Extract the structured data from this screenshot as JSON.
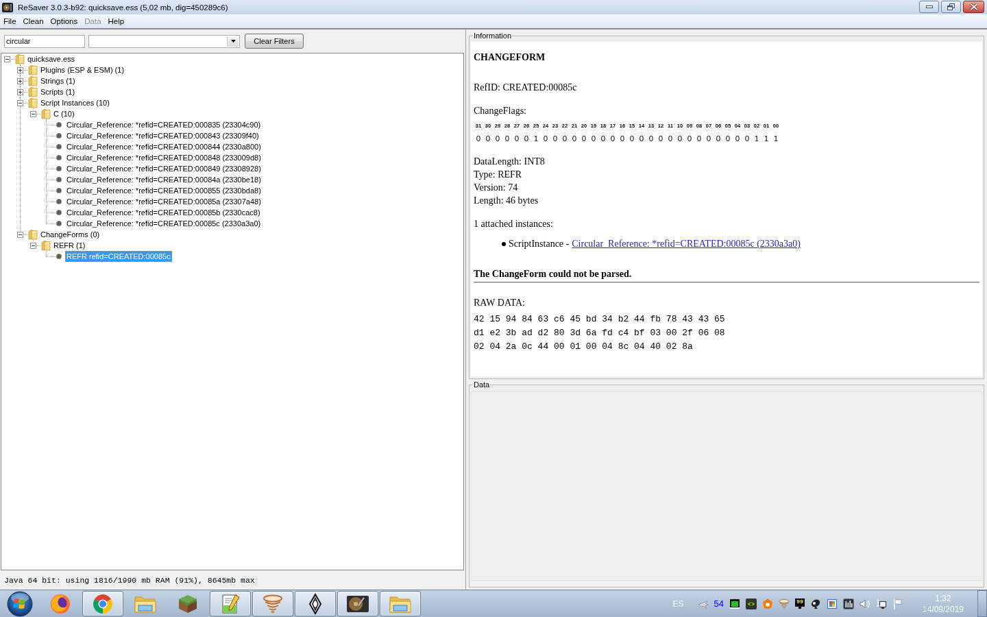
{
  "window": {
    "title": "ReSaver 3.0.3-b92: quicksave.ess (5,02 mb, dig=450289c6)"
  },
  "menu": [
    {
      "label": "File",
      "disabled": false
    },
    {
      "label": "Clean",
      "disabled": false
    },
    {
      "label": "Options",
      "disabled": false
    },
    {
      "label": "Data",
      "disabled": true
    },
    {
      "label": "Help",
      "disabled": false
    }
  ],
  "filter": {
    "text": {
      "value": "circular"
    },
    "button": "Clear Filters"
  },
  "tree": [
    {
      "label": "quicksave.ess",
      "kind": "folder",
      "expanded": true,
      "selected": false,
      "children": [
        {
          "label": "Plugins (ESP & ESM) (1)",
          "kind": "folder",
          "expanded": false,
          "selected": false
        },
        {
          "label": "Strings (1)",
          "kind": "folder",
          "expanded": false,
          "selected": false
        },
        {
          "label": "Scripts (1)",
          "kind": "folder",
          "expanded": false,
          "selected": false
        },
        {
          "label": "Script Instances (10)",
          "kind": "folder",
          "expanded": true,
          "selected": false,
          "children": [
            {
              "label": "C (10)",
              "kind": "folder",
              "expanded": true,
              "selected": false,
              "children": [
                {
                  "label": "Circular_Reference: *refid=CREATED:000835 (23304c90)",
                  "kind": "leaf",
                  "selected": false
                },
                {
                  "label": "Circular_Reference: *refid=CREATED:000843 (23309f40)",
                  "kind": "leaf",
                  "selected": false
                },
                {
                  "label": "Circular_Reference: *refid=CREATED:000844 (2330a800)",
                  "kind": "leaf",
                  "selected": false
                },
                {
                  "label": "Circular_Reference: *refid=CREATED:000848 (233009d8)",
                  "kind": "leaf",
                  "selected": false
                },
                {
                  "label": "Circular_Reference: *refid=CREATED:000849 (23308928)",
                  "kind": "leaf",
                  "selected": false
                },
                {
                  "label": "Circular_Reference: *refid=CREATED:00084a (2330be18)",
                  "kind": "leaf",
                  "selected": false
                },
                {
                  "label": "Circular_Reference: *refid=CREATED:000855 (2330bda8)",
                  "kind": "leaf",
                  "selected": false
                },
                {
                  "label": "Circular_Reference: *refid=CREATED:00085a (23307a48)",
                  "kind": "leaf",
                  "selected": false
                },
                {
                  "label": "Circular_Reference: *refid=CREATED:00085b (2330cac8)",
                  "kind": "leaf",
                  "selected": false
                },
                {
                  "label": "Circular_Reference: *refid=CREATED:00085c (2330a3a0)",
                  "kind": "leaf",
                  "selected": false
                }
              ]
            }
          ]
        },
        {
          "label": "ChangeForms (0)",
          "kind": "folder",
          "expanded": true,
          "selected": false,
          "children": [
            {
              "label": "REFR (1)",
              "kind": "folder",
              "expanded": true,
              "selected": false,
              "children": [
                {
                  "label": "REFR refid=CREATED:00085c",
                  "kind": "leaf",
                  "selected": true
                }
              ]
            }
          ]
        }
      ]
    }
  ],
  "status_bar": "Java 64 bit: using 1816/1990 mb RAM (91%), 8645mb max",
  "information": {
    "title": "Information",
    "heading": "CHANGEFORM",
    "refid": "RefID: CREATED:00085c",
    "flags": {
      "label": "ChangeFlags:",
      "bit_numbers": [
        "31",
        "30",
        "29",
        "28",
        "27",
        "26",
        "25",
        "24",
        "23",
        "22",
        "21",
        "20",
        "19",
        "18",
        "17",
        "16",
        "15",
        "14",
        "13",
        "12",
        "11",
        "10",
        "09",
        "08",
        "07",
        "06",
        "05",
        "04",
        "03",
        "02",
        "01",
        "00"
      ],
      "bits": [
        "0",
        "0",
        "0",
        "0",
        "0",
        "0",
        "1",
        "0",
        "0",
        "0",
        "0",
        "0",
        "0",
        "0",
        "0",
        "0",
        "0",
        "0",
        "0",
        "0",
        "0",
        "0",
        "0",
        "0",
        "0",
        "0",
        "0",
        "0",
        "0",
        "1",
        "1",
        "1"
      ]
    },
    "fields": [
      "DataLength: INT8",
      "Type: REFR",
      "Version: 74",
      "Length: 46 bytes"
    ],
    "attached_label": "1 attached instances:",
    "attached": [
      {
        "prefix": "ScriptInstance -",
        "link": "Circular_Reference: *refid=CREATED:00085c (2330a3a0)"
      }
    ],
    "parse_error": "The ChangeForm could not be parsed.",
    "raw_label": "RAW DATA:",
    "raw_rows": [
      "42 15 94 84 63 c6 45 bd 34 b2 44 fb 78 43 43 65",
      "d1 e2 3b ad d2 80 3d 6a fd c4 bf 03 00 2f 06 08",
      "02 04 2a 0c 44 00 01 00 04 8c 04 40 02 8a"
    ]
  },
  "data_panel": {
    "title": "Data"
  },
  "taskbar": {
    "apps": [
      {
        "running": false
      },
      {
        "running": true
      },
      {
        "running": false
      },
      {
        "running": false
      },
      {
        "running": true
      },
      {
        "running": true
      },
      {
        "running": true
      },
      {
        "running": true
      },
      {
        "running": true
      }
    ],
    "tray": {
      "language": "ES",
      "reading": "54",
      "badge": "99",
      "time": "1:32",
      "date": "14/09/2019"
    }
  }
}
